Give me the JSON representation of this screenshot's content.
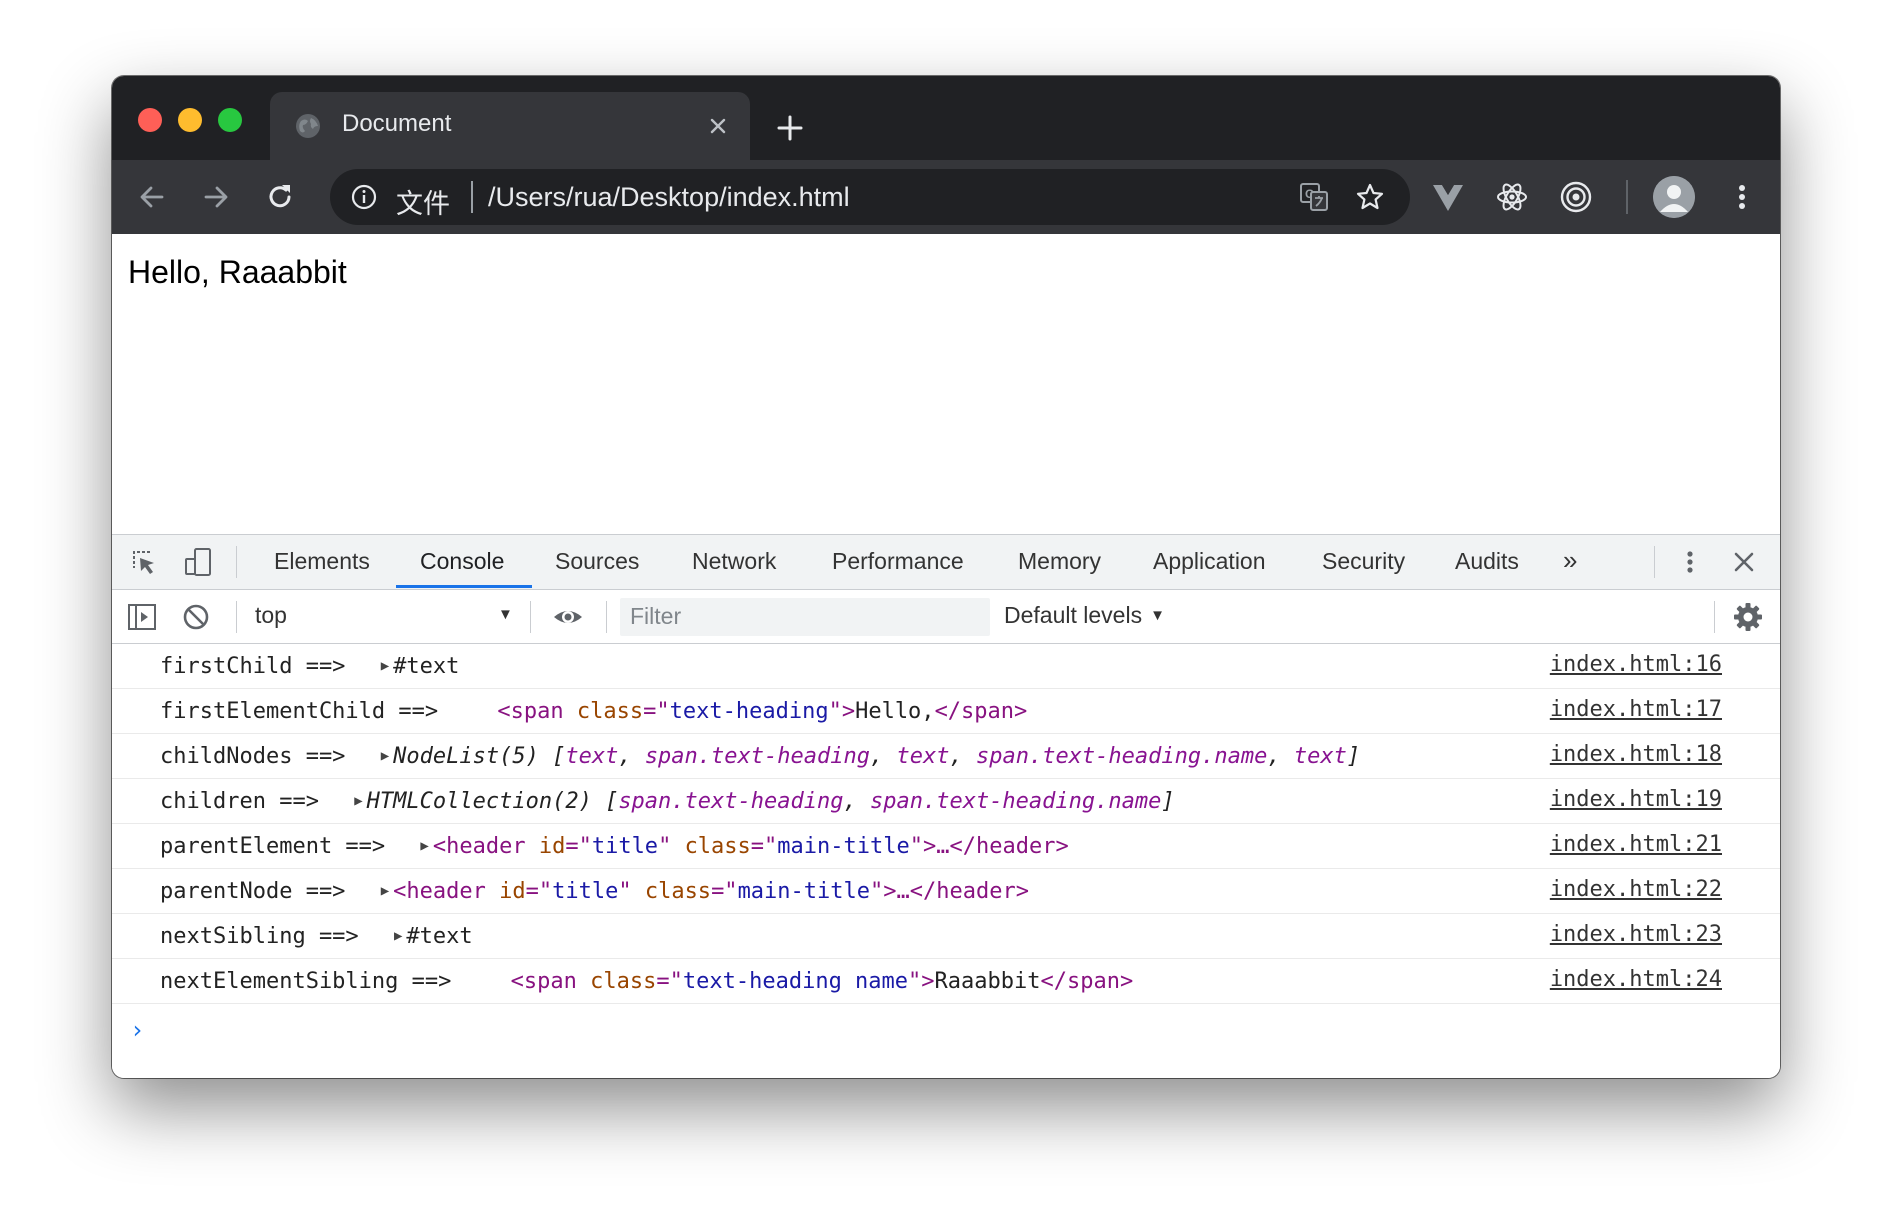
{
  "tab": {
    "title": "Document"
  },
  "omnibox": {
    "scheme_label": "文件",
    "url": "/Users/rua/Desktop/index.html"
  },
  "page": {
    "text": "Hello, Raaabbit"
  },
  "devtools": {
    "tabs": [
      "Elements",
      "Console",
      "Sources",
      "Network",
      "Performance",
      "Memory",
      "Application",
      "Security",
      "Audits"
    ],
    "active_tab": "Console",
    "more_tabs": "»",
    "context": "top",
    "filter_placeholder": "Filter",
    "levels": "Default levels",
    "prompt": "›"
  },
  "console": [
    {
      "label": "firstChild ==>",
      "value": "#text",
      "source": "index.html:16"
    },
    {
      "label": "firstElementChild ==>",
      "tag_open": "<span",
      "attr": "class",
      "eq": "=\"",
      "attr_value": "text-heading",
      "close_q": "\">",
      "inner": "Hello,",
      "tag_close": "</span>",
      "source": "index.html:17"
    },
    {
      "label": "childNodes ==>",
      "type": "NodeList(5)",
      "open": "[",
      "items": [
        "text",
        "span.text-heading",
        "text",
        "span.text-heading.name",
        "text"
      ],
      "sep": ", ",
      "close": "]",
      "source": "index.html:18"
    },
    {
      "label": "children ==>",
      "type": "HTMLCollection(2)",
      "open": "[",
      "items": [
        "span.text-heading",
        "span.text-heading.name"
      ],
      "sep": ", ",
      "close": "]",
      "source": "index.html:19"
    },
    {
      "label": "parentElement ==>",
      "tag_open": "<header",
      "attr1": "id",
      "val1": "title",
      "attr2": "class",
      "val2": "main-title",
      "rest": "\">…</header>",
      "source": "index.html:21"
    },
    {
      "label": "parentNode ==>",
      "tag_open": "<header",
      "attr1": "id",
      "val1": "title",
      "attr2": "class",
      "val2": "main-title",
      "rest": "\">…</header>",
      "source": "index.html:22"
    },
    {
      "label": "nextSibling ==>",
      "value": "#text",
      "source": "index.html:23"
    },
    {
      "label": "nextElementSibling ==>",
      "tag_open": "<span",
      "attr": "class",
      "eq": "=\"",
      "attr_value": "text-heading name",
      "close_q": "\">",
      "inner": "Raaabbit",
      "tag_close": "</span>",
      "source": "index.html:24"
    }
  ],
  "colors": {
    "accent": "#1a73e8",
    "tag": "#881280",
    "attr": "#994500",
    "value": "#1a1aa6",
    "object": "#881391"
  }
}
